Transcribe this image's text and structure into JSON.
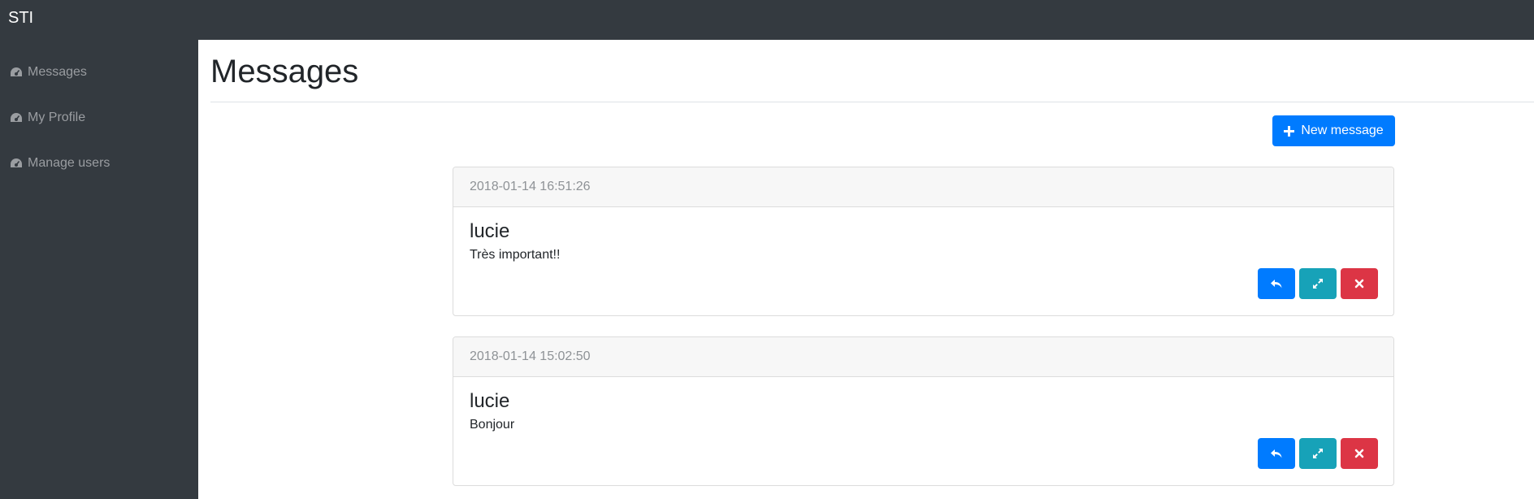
{
  "app": {
    "brand": "STI"
  },
  "sidebar": {
    "items": [
      {
        "label": "Messages",
        "icon": "dashboard-icon"
      },
      {
        "label": "My Profile",
        "icon": "dashboard-icon"
      },
      {
        "label": "Manage users",
        "icon": "dashboard-icon"
      }
    ]
  },
  "main": {
    "title": "Messages",
    "new_message_label": "New message"
  },
  "messages": [
    {
      "date": "2018-01-14 16:51:26",
      "author": "lucie",
      "text": "Très important!!"
    },
    {
      "date": "2018-01-14 15:02:50",
      "author": "lucie",
      "text": "Bonjour"
    }
  ],
  "colors": {
    "topbar": "#343a40",
    "primary": "#007bff",
    "info": "#17a2b8",
    "danger": "#dc3545"
  }
}
